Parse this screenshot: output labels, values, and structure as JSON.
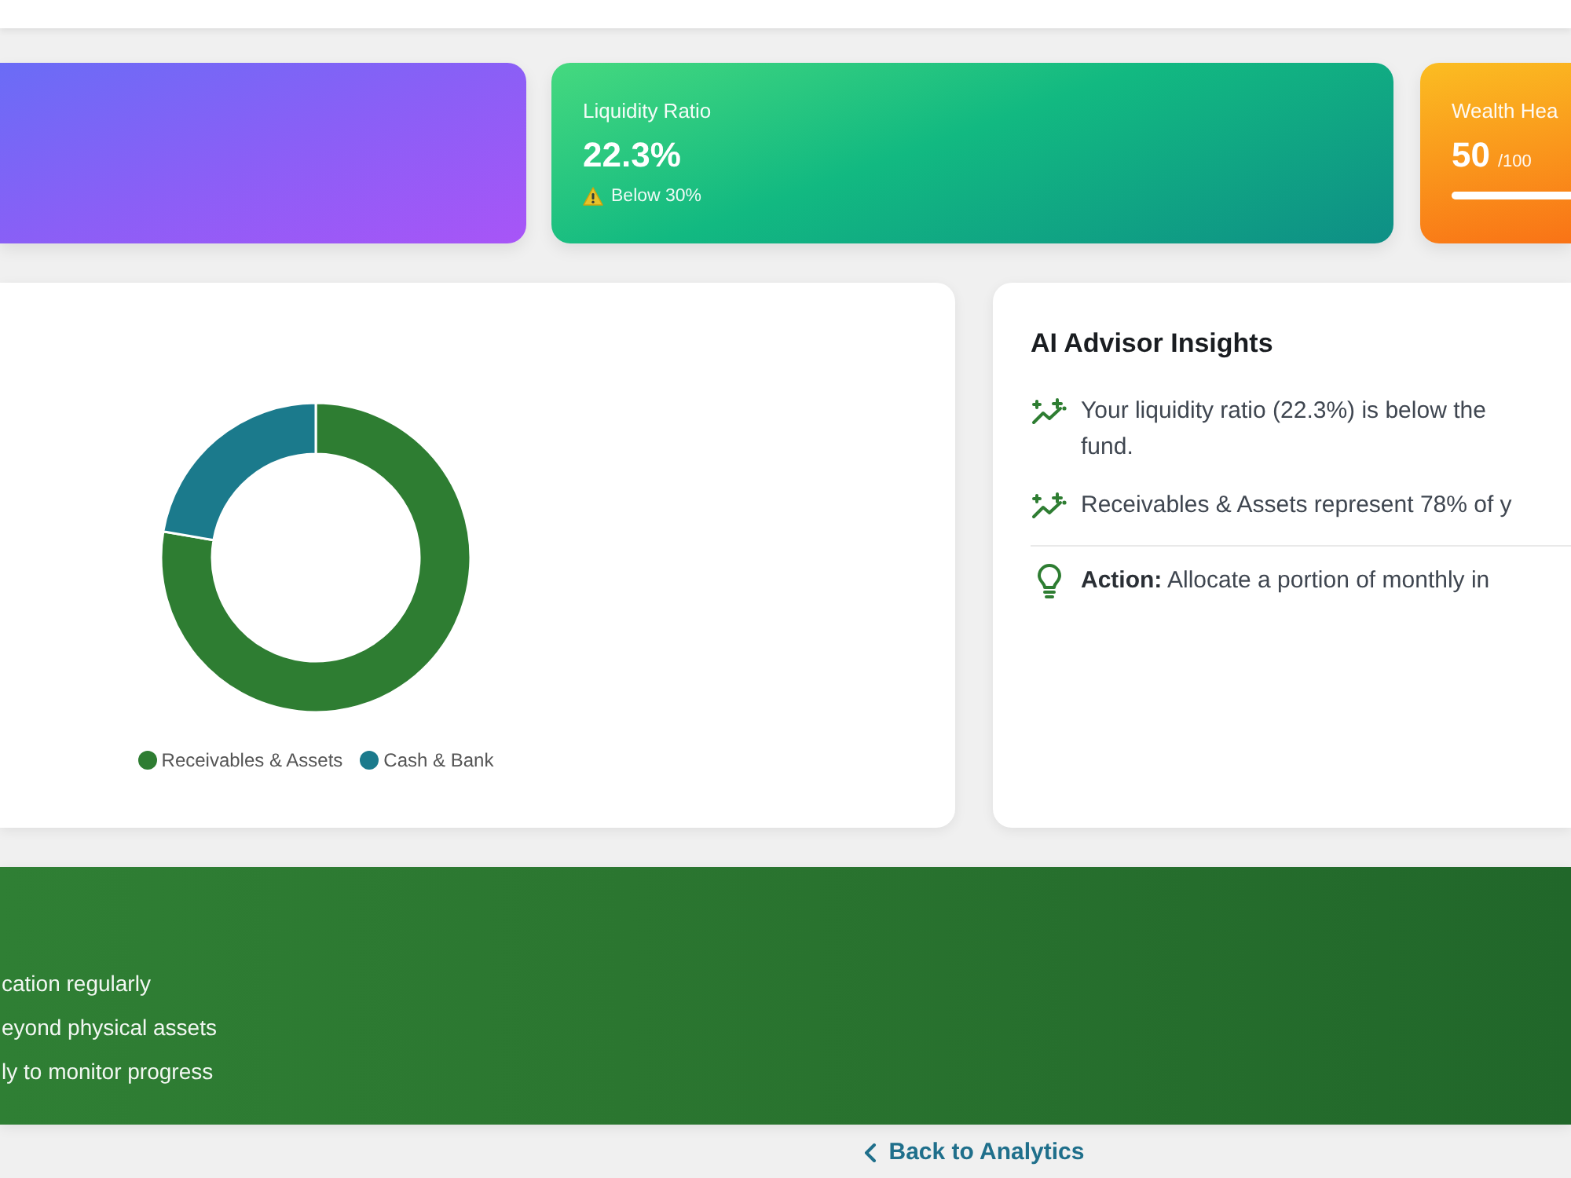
{
  "stat_cards": [
    {
      "kind": "blank"
    },
    {
      "kind": "ratio",
      "label": "Liquidity Ratio",
      "value": "22.3%",
      "warning": true,
      "note": "Below 30%"
    },
    {
      "kind": "score",
      "label": "Wealth Hea",
      "value": "50",
      "scale": "/100",
      "level": 0.5
    }
  ],
  "allocation_chart": {
    "legend": [
      {
        "label": "Receivables & Assets",
        "color": "#2e7d32"
      },
      {
        "label": "Cash & Bank",
        "color": "#1b7a8c"
      }
    ]
  },
  "insights": {
    "title": "AI Advisor Insights",
    "items": [
      {
        "kind": "trend",
        "lines": [
          "Your liquidity ratio (22.3%) is below the",
          "fund."
        ]
      },
      {
        "kind": "trend",
        "lines": [
          "Receivables & Assets represent 78% of y"
        ]
      },
      {
        "kind": "action",
        "lines": [
          "**Action:** Allocate a portion of monthly in"
        ]
      }
    ]
  },
  "tips": [
    "cation regularly",
    "eyond physical assets",
    "ly to monitor progress"
  ],
  "back_link": {
    "label": "Back to Analytics"
  }
}
